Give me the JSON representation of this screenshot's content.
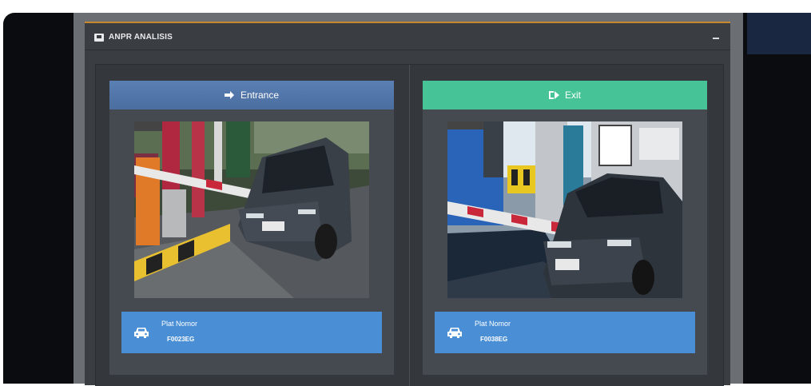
{
  "panel": {
    "title": "ANPR ANALISIS",
    "accent_color": "#c8892d",
    "icon": "camera-icon"
  },
  "entrance": {
    "label": "Entrance",
    "icon": "sign-in-icon",
    "color": "#5a7fb4",
    "plate_label": "Plat Nomor",
    "plate_value": "F0023EG",
    "plate_icon": "car-icon"
  },
  "exit": {
    "label": "Exit",
    "icon": "sign-out-icon",
    "color": "#46c497",
    "plate_label": "Plat Nomor",
    "plate_value": "F0038EG",
    "plate_icon": "car-icon"
  }
}
